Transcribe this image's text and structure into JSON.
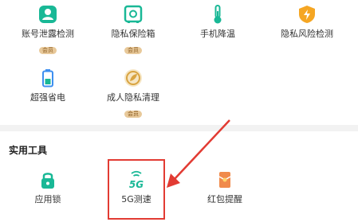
{
  "security_tools": [
    {
      "label": "账号泄露检测",
      "badge": "会员",
      "icon": "person-shield-icon"
    },
    {
      "label": "隐私保险箱",
      "badge": "会员",
      "icon": "safe-icon"
    },
    {
      "label": "手机降温",
      "badge": "",
      "icon": "thermometer-icon"
    },
    {
      "label": "隐私风险检测",
      "badge": "",
      "icon": "shield-bolt-icon"
    },
    {
      "label": "超强省电",
      "badge": "",
      "icon": "battery-icon"
    },
    {
      "label": "成人隐私清理",
      "badge": "会员",
      "icon": "leaf-clean-icon"
    }
  ],
  "utility_section": {
    "title": "实用工具",
    "items": [
      {
        "label": "应用锁",
        "icon": "lock-icon"
      },
      {
        "label": "5G测速",
        "icon": "5g-icon",
        "icon_text": "5G"
      },
      {
        "label": "红包提醒",
        "icon": "red-envelope-icon"
      }
    ]
  },
  "colors": {
    "teal": "#19b896",
    "orange": "#f5a623",
    "blue": "#3d8ff0",
    "highlight": "#e23b33",
    "badge": "#e8c99a"
  }
}
